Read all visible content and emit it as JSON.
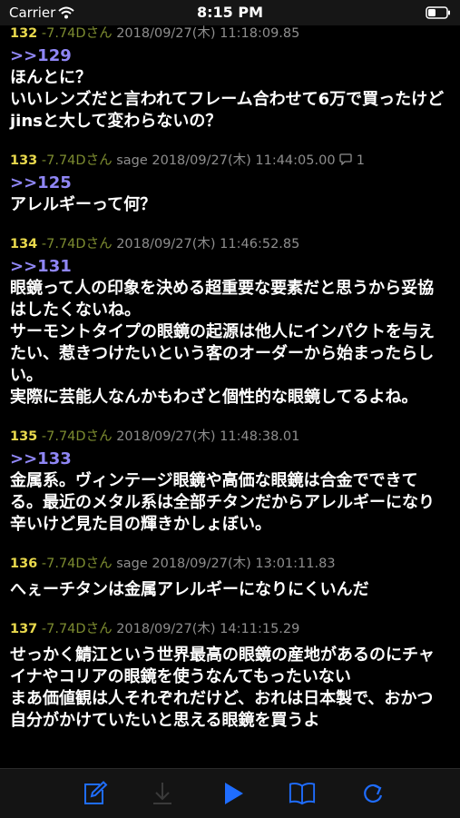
{
  "status": {
    "carrier": "Carrier",
    "time": "8:15 PM"
  },
  "posts": [
    {
      "num": "132",
      "name": "-7.74Dさん",
      "sage": "",
      "date": "2018/09/27(木) 11:18:09.85",
      "replies": "",
      "anchor": ">>129",
      "lines": [
        "ほんとに？",
        "いいレンズだと言われてフレーム合わせて6万で買ったけどjinsと大して変わらないの？"
      ]
    },
    {
      "num": "133",
      "name": "-7.74Dさん",
      "sage": "sage",
      "date": "2018/09/27(木) 11:44:05.00",
      "replies": "1",
      "anchor": ">>125",
      "lines": [
        "アレルギーって何？"
      ]
    },
    {
      "num": "134",
      "name": "-7.74Dさん",
      "sage": "",
      "date": "2018/09/27(木) 11:46:52.85",
      "replies": "",
      "anchor": ">>131",
      "lines": [
        "眼鏡って人の印象を決める超重要な要素だと思うから妥協はしたくないね。",
        "サーモントタイプの眼鏡の起源は他人にインパクトを与えたい、惹きつけたいという客のオーダーから始まったらしい。",
        "実際に芸能人なんかもわざと個性的な眼鏡してるよね。"
      ]
    },
    {
      "num": "135",
      "name": "-7.74Dさん",
      "sage": "",
      "date": "2018/09/27(木) 11:48:38.01",
      "replies": "",
      "anchor": ">>133",
      "lines": [
        "金属系。ヴィンテージ眼鏡や高価な眼鏡は合金でできてる。最近のメタル系は全部チタンだからアレルギーになり辛いけど見た目の輝きかしょぼい。"
      ]
    },
    {
      "num": "136",
      "name": "-7.74Dさん",
      "sage": "sage",
      "date": "2018/09/27(木) 13:01:11.83",
      "replies": "",
      "anchor": "",
      "lines": [
        "へぇーチタンは金属アレルギーになりにくいんだ"
      ]
    },
    {
      "num": "137",
      "name": "-7.74Dさん",
      "sage": "",
      "date": "2018/09/27(木) 14:11:15.29",
      "replies": "",
      "anchor": "",
      "lines": [
        "せっかく鯖江という世界最高の眼鏡の産地があるのにチャイナやコリアの眼鏡を使うなんてもったいない",
        "まあ価値観は人それぞれだけど、おれは日本製で、おかつ自分がかけていたいと思える眼鏡を買うよ"
      ]
    }
  ],
  "toolbar": {
    "icons": [
      "compose-icon",
      "download-icon",
      "play-icon",
      "book-icon",
      "refresh-icon"
    ],
    "accent": "#1f6dff",
    "disabled": "#3a3a3a"
  }
}
